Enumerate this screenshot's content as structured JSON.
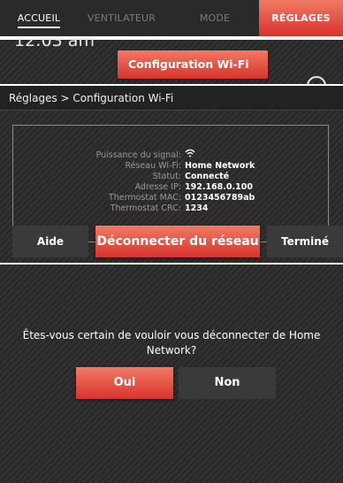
{
  "colors": {
    "accent": "#e0443a",
    "background": "#2e2e2e",
    "secondary_button": "#3a3a3a"
  },
  "nav": {
    "tabs": [
      "ACCUEIL",
      "VENTILATEUR",
      "MODE",
      "RÉGLAGES"
    ],
    "active_underlined": "ACCUEIL",
    "active_highlighted": "RÉGLAGES"
  },
  "home": {
    "time": "12:03 am",
    "wifi_button": "Configuration Wi-Fi",
    "expand_icon": "chevron-down-icon"
  },
  "wifi_settings": {
    "breadcrumb": "Réglages > Configuration Wi-Fi",
    "rows": [
      {
        "label": "Puissance du signal:",
        "value": ""
      },
      {
        "label": "Réseau Wi-Fi:",
        "value": "Home Network"
      },
      {
        "label": "Statut:",
        "value": "Connecté"
      },
      {
        "label": "Adresse IP:",
        "value": "192.168.0.100"
      },
      {
        "label": "Thermostat MAC:",
        "value": "0123456789ab"
      },
      {
        "label": "Thermostat CRC:",
        "value": "1234"
      }
    ],
    "signal_icon": "wifi-signal-icon",
    "buttons": {
      "help": "Aide",
      "disconnect": "Déconnecter du réseau",
      "done": "Terminé"
    }
  },
  "confirm": {
    "question_line1": "Êtes-vous certain de vouloir vous déconnecter de Home",
    "question_line2": "Network?",
    "yes": "Oui",
    "no": "Non"
  }
}
